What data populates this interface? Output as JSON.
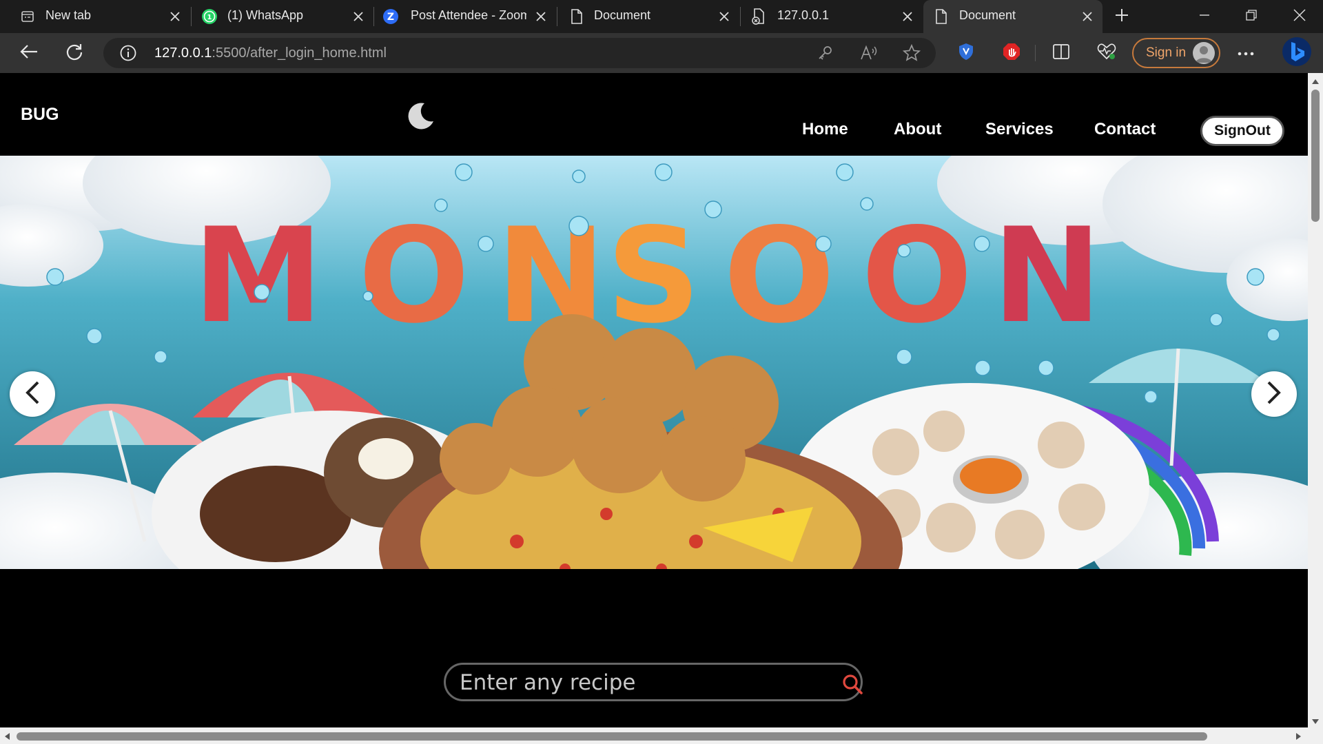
{
  "browser": {
    "tabs": [
      {
        "title": "New tab",
        "icon": "new-tab-icon"
      },
      {
        "title": "(1) WhatsApp",
        "icon": "whatsapp-icon"
      },
      {
        "title": "Post Attendee - Zoom",
        "icon": "zoom-icon"
      },
      {
        "title": "Document",
        "icon": "document-icon"
      },
      {
        "title": "127.0.0.1",
        "icon": "file-error-icon"
      },
      {
        "title": "Document",
        "icon": "document-icon"
      }
    ],
    "active_tab": 5,
    "url_host": "127.0.0.1",
    "url_path": ":5500/after_login_home.html",
    "sign_in_label": "Sign in"
  },
  "page": {
    "brand": "BUG",
    "nav": {
      "home": "Home",
      "about": "About",
      "services": "Services",
      "contact": "Contact",
      "signout": "SignOut"
    },
    "banner": {
      "headline": "MONSOON"
    },
    "search": {
      "placeholder": "Enter any recipe"
    }
  },
  "colors": {
    "accent": "#e0483e",
    "signin_border": "#c77a3c"
  }
}
